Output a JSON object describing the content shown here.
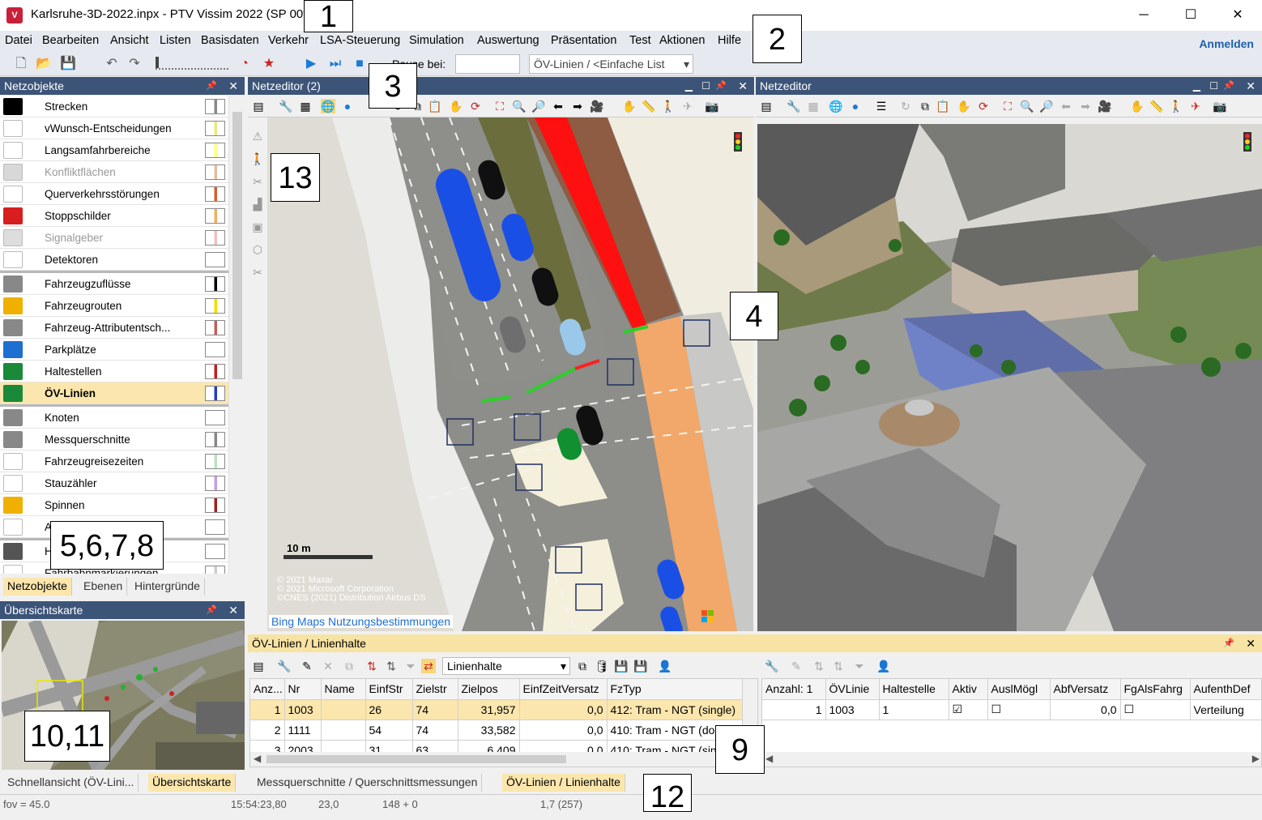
{
  "window": {
    "title": "Karlsruhe-3D-2022.inpx - PTV Vissim 2022 (SP 00*)",
    "min": "─",
    "max": "☐",
    "close": "✕"
  },
  "menu": [
    "Datei",
    "Bearbeiten",
    "Ansicht",
    "Listen",
    "Basisdaten",
    "Verkehr",
    "LSA-Steuerung",
    "Simulation",
    "Auswertung",
    "Präsentation",
    "Test",
    "Aktionen",
    "Hilfe"
  ],
  "anmelden": "Anmelden",
  "toolbar": {
    "pause_label": "Pause bei:",
    "list_combo": "ÖV-Linien / <Einfache List"
  },
  "netzobjekte": {
    "title": "Netzobjekte",
    "items": [
      {
        "label": "Strecken",
        "icon": "road-icon",
        "bg": "#000000"
      },
      {
        "label": "vWunsch-Entscheidungen",
        "icon": "speed-sign-icon",
        "bg": "#ffffff"
      },
      {
        "label": "Langsamfahrbereiche",
        "icon": "warning-sign-icon",
        "bg": "#ffffff"
      },
      {
        "label": "Konfliktflächen",
        "icon": "conflict-area-icon",
        "bg": "#d8d8d8"
      },
      {
        "label": "Querverkehrsstörungen",
        "icon": "yield-sign-icon",
        "bg": "#ffffff"
      },
      {
        "label": "Stoppschilder",
        "icon": "stop-sign-icon",
        "bg": "#d81e1e"
      },
      {
        "label": "Signalgeber",
        "icon": "signal-icon",
        "bg": "#dddddd"
      },
      {
        "label": "Detektoren",
        "icon": "detector-icon",
        "bg": "#ffffff"
      },
      {
        "label": "Fahrzeugzuflüsse",
        "icon": "vehicle-input-icon",
        "bg": "#888888"
      },
      {
        "label": "Fahrzeugrouten",
        "icon": "route-icon",
        "bg": "#f0b000"
      },
      {
        "label": "Fahrzeug-Attributentsch...",
        "icon": "vehicle-attr-icon",
        "bg": "#888888"
      },
      {
        "label": "Parkplätze",
        "icon": "parking-icon",
        "bg": "#1d6fd0"
      },
      {
        "label": "Haltestellen",
        "icon": "bus-stop-icon",
        "bg": "#1a8a3a"
      },
      {
        "label": "ÖV-Linien",
        "icon": "pt-line-icon",
        "bg": "#1a8a3a"
      },
      {
        "label": "Knoten",
        "icon": "node-icon",
        "bg": "#888888"
      },
      {
        "label": "Messquerschnitte",
        "icon": "measurement-icon",
        "bg": "#888888"
      },
      {
        "label": "Fahrzeugreisezeiten",
        "icon": "travel-time-icon",
        "bg": "#ffffff"
      },
      {
        "label": "Stauzähler",
        "icon": "queue-counter-icon",
        "bg": "#ffffff"
      },
      {
        "label": "Spinnen",
        "icon": "spider-icon",
        "bg": "#f0b000"
      },
      {
        "label": "A",
        "icon": "area-icon",
        "bg": "#ffffff"
      },
      {
        "label": "H",
        "icon": "background-icon",
        "bg": "#555555"
      },
      {
        "label": "Fahrbahnmarkierungen",
        "icon": "road-marking-icon",
        "bg": "#ffffff"
      }
    ],
    "tabs": [
      "Netzobjekte",
      "Ebenen",
      "Hintergründe"
    ]
  },
  "uebersicht": {
    "title": "Übersichtskarte",
    "tabs": [
      "Schnellansicht (ÖV-Lini...",
      "Übersichtskarte"
    ]
  },
  "editor1": {
    "title": "Netzeditor (2)",
    "scale": "10 m",
    "copyright": [
      "© 2021 Maxar",
      "© 2021 Microsoft Corporation",
      "©CNES (2021) Distribution Airbus DS"
    ],
    "bing": "Bing Maps Nutzungsbestimmungen"
  },
  "editor2": {
    "title": "Netzeditor"
  },
  "grid": {
    "title": "ÖV-Linien / Linienhalte",
    "combo": "Linienhalte",
    "left_cols": [
      "Anz...",
      "Nr",
      "Name",
      "EinfStr",
      "Zielstr",
      "Zielpos",
      "EinfZeitVersatz",
      "FzTyp"
    ],
    "left_rows": [
      [
        "1",
        "1003",
        "",
        "26",
        "74",
        "31,957",
        "0,0",
        "412: Tram - NGT (single)"
      ],
      [
        "2",
        "1111",
        "",
        "54",
        "74",
        "33,582",
        "0,0",
        "410: Tram - NGT (do"
      ],
      [
        "3",
        "2003",
        "",
        "31",
        "63",
        "6,409",
        "0,0",
        "410: Tram - NGT (sin"
      ]
    ],
    "right_cols": [
      "Anzahl: 1",
      "ÖVLinie",
      "Haltestelle",
      "Aktiv",
      "AuslMögl",
      "AbfVersatz",
      "FgAlsFahrg",
      "AufenthDef"
    ],
    "right_rows": [
      [
        "1",
        "1003",
        "1",
        "☑",
        "☐",
        "0,0",
        "☐",
        "Verteilung"
      ]
    ],
    "tabs": [
      "Messquerschnitte / Querschnittsmessungen",
      "ÖV-Linien / Linienhalte"
    ]
  },
  "status": {
    "fov": "fov = 45.0",
    "time": "15:54:23,80",
    "v1": "23,0",
    "v2": "148 + 0",
    "v3": "1,7 (257)"
  },
  "callouts": [
    "1",
    "2",
    "3",
    "4",
    "5,6,7,8",
    "9",
    "10,11",
    "12",
    "13"
  ]
}
